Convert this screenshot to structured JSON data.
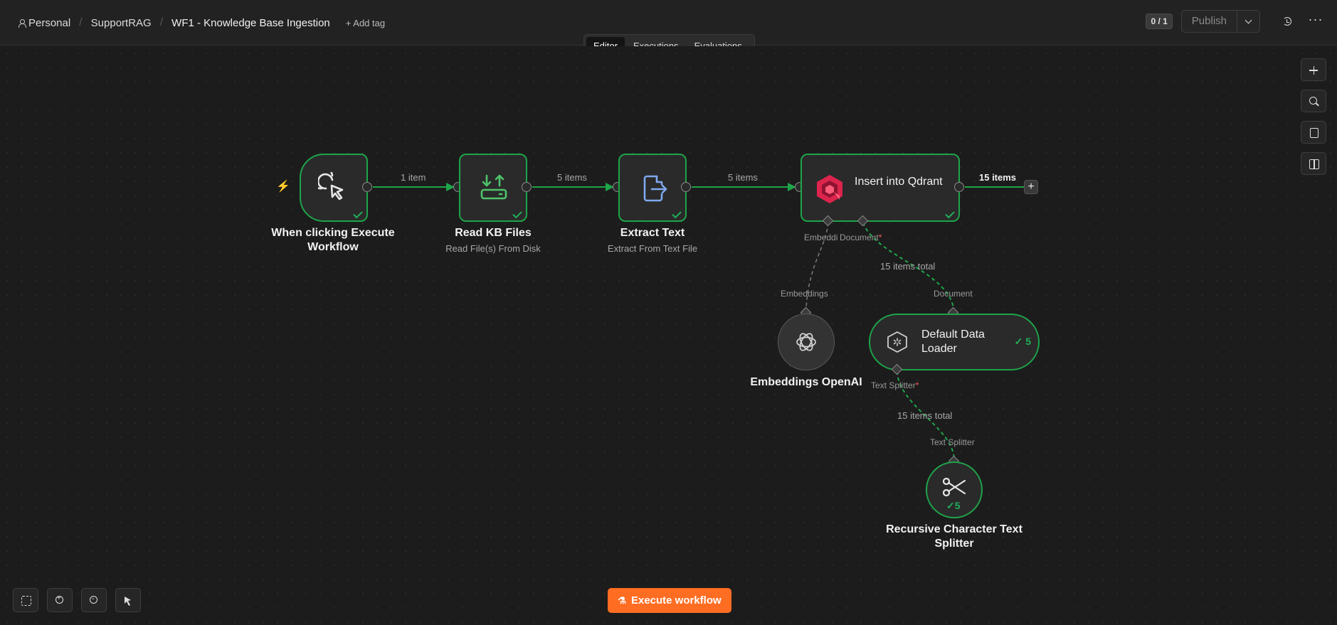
{
  "header": {
    "breadcrumb": [
      "Personal",
      "SupportRAG",
      "WF1 - Knowledge Base Ingestion"
    ],
    "add_tag": "+ Add tag",
    "version_counter": "0 / 1",
    "publish_label": "Publish"
  },
  "tabs": [
    {
      "label": "Editor",
      "active": true
    },
    {
      "label": "Executions",
      "active": false
    },
    {
      "label": "Evaluations",
      "active": false
    }
  ],
  "nodes": {
    "trigger": {
      "title": "When clicking Execute Workflow",
      "status": "success"
    },
    "read_files": {
      "title": "Read KB Files",
      "subtitle": "Read File(s) From Disk",
      "status": "success"
    },
    "extract": {
      "title": "Extract Text",
      "subtitle": "Extract From Text File",
      "status": "success"
    },
    "qdrant": {
      "title": "Insert into Qdrant",
      "status": "success",
      "out_label": "15 items"
    },
    "embeddings": {
      "title": "Embeddings OpenAI"
    },
    "loader": {
      "title": "Default Data Loader",
      "run_count": "5"
    },
    "splitter": {
      "title": "Recursive Character Text Splitter",
      "run_count": "5"
    }
  },
  "edges": {
    "trigger_to_read": "1 item",
    "read_to_extract": "5 items",
    "extract_to_qdrant": "5 items",
    "loader_to_qdrant": "15 items total",
    "splitter_to_loader": "15 items total"
  },
  "ports": {
    "qdrant_embedding": "Embeddi",
    "qdrant_document": "Document",
    "embeddings_top": "Embeddings",
    "loader_top": "Document",
    "loader_bottom": "Text Splitter",
    "splitter_top": "Text Splitter",
    "required_mark": "*"
  },
  "footer": {
    "execute_label": "Execute workflow"
  },
  "colors": {
    "accent": "#ff6d23",
    "success": "#1ea44a",
    "background": "#1c1c1c"
  }
}
